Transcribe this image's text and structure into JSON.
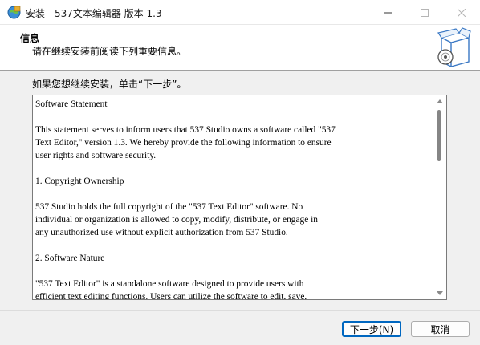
{
  "window": {
    "title": "安装 - 537文本编辑器 版本 1.3",
    "icons": {
      "app": "installer-globe-icon",
      "minimize": "minimize-icon",
      "maximize": "maximize-icon",
      "close": "close-icon"
    }
  },
  "header": {
    "title": "信息",
    "subtitle": "请在继续安装前阅读下列重要信息。",
    "image": "software-box-cd-icon"
  },
  "prompt": "如果您想继续安装，单击“下一步”。",
  "memo": {
    "lines": [
      "Software Statement",
      "",
      "This statement serves to inform users that 537 Studio owns a software called \"537",
      "Text Editor,\" version 1.3. We hereby provide the following information to ensure",
      "user rights and software security.",
      "",
      "1. Copyright Ownership",
      "",
      "537 Studio holds the full copyright of the \"537 Text Editor\" software. No",
      "individual or organization is allowed to copy, modify, distribute, or engage in",
      "any unauthorized use without explicit authorization from 537 Studio.",
      "",
      "2. Software Nature",
      "",
      "\"537 Text Editor\" is a standalone software designed to provide users with",
      "efficient text editing functions. Users can utilize the software to edit, save,"
    ]
  },
  "buttons": {
    "next": "下一步(N)",
    "cancel": "取消"
  },
  "colors": {
    "accent": "#0067c0",
    "header_bg": "#ffffff",
    "body_bg": "#f0f0f0"
  }
}
